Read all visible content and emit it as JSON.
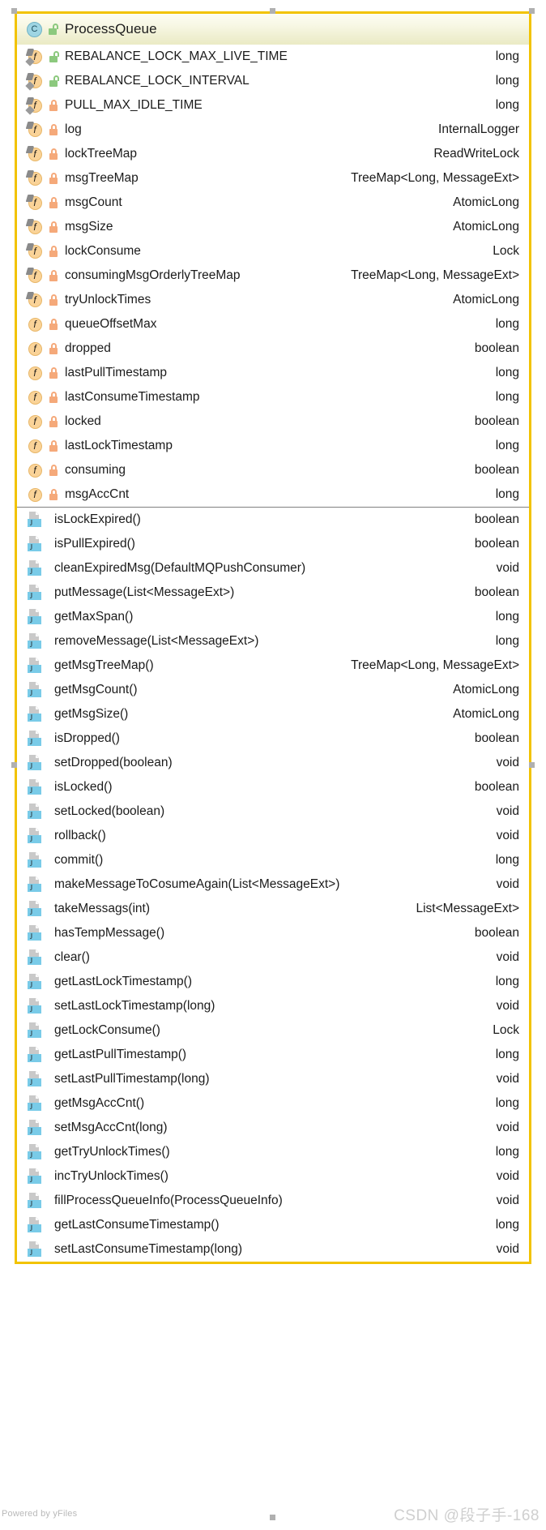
{
  "node": {
    "class_icon": "class-circle-icon",
    "visibility_icon": "unlock-icon",
    "name": "ProcessQueue"
  },
  "fields": [
    {
      "name": "REBALANCE_LOCK_MAX_LIVE_TIME",
      "type": "long",
      "visibility": "public",
      "static": true,
      "final": true
    },
    {
      "name": "REBALANCE_LOCK_INTERVAL",
      "type": "long",
      "visibility": "public",
      "static": true,
      "final": true
    },
    {
      "name": "PULL_MAX_IDLE_TIME",
      "type": "long",
      "visibility": "private",
      "static": true,
      "final": true
    },
    {
      "name": "log",
      "type": "InternalLogger",
      "visibility": "private",
      "static": false,
      "final": true
    },
    {
      "name": "lockTreeMap",
      "type": "ReadWriteLock",
      "visibility": "private",
      "static": false,
      "final": true
    },
    {
      "name": "msgTreeMap",
      "type": "TreeMap<Long, MessageExt>",
      "visibility": "private",
      "static": false,
      "final": true
    },
    {
      "name": "msgCount",
      "type": "AtomicLong",
      "visibility": "private",
      "static": false,
      "final": true
    },
    {
      "name": "msgSize",
      "type": "AtomicLong",
      "visibility": "private",
      "static": false,
      "final": true
    },
    {
      "name": "lockConsume",
      "type": "Lock",
      "visibility": "private",
      "static": false,
      "final": true
    },
    {
      "name": "consumingMsgOrderlyTreeMap",
      "type": "TreeMap<Long, MessageExt>",
      "visibility": "private",
      "static": false,
      "final": true
    },
    {
      "name": "tryUnlockTimes",
      "type": "AtomicLong",
      "visibility": "private",
      "static": false,
      "final": true
    },
    {
      "name": "queueOffsetMax",
      "type": "long",
      "visibility": "private",
      "static": false,
      "final": false
    },
    {
      "name": "dropped",
      "type": "boolean",
      "visibility": "private",
      "static": false,
      "final": false
    },
    {
      "name": "lastPullTimestamp",
      "type": "long",
      "visibility": "private",
      "static": false,
      "final": false
    },
    {
      "name": "lastConsumeTimestamp",
      "type": "long",
      "visibility": "private",
      "static": false,
      "final": false
    },
    {
      "name": "locked",
      "type": "boolean",
      "visibility": "private",
      "static": false,
      "final": false
    },
    {
      "name": "lastLockTimestamp",
      "type": "long",
      "visibility": "private",
      "static": false,
      "final": false
    },
    {
      "name": "consuming",
      "type": "boolean",
      "visibility": "private",
      "static": false,
      "final": false
    },
    {
      "name": "msgAccCnt",
      "type": "long",
      "visibility": "private",
      "static": false,
      "final": false
    }
  ],
  "methods": [
    {
      "name": "isLockExpired()",
      "type": "boolean"
    },
    {
      "name": "isPullExpired()",
      "type": "boolean"
    },
    {
      "name": "cleanExpiredMsg(DefaultMQPushConsumer)",
      "type": "void"
    },
    {
      "name": "putMessage(List<MessageExt>)",
      "type": "boolean"
    },
    {
      "name": "getMaxSpan()",
      "type": "long"
    },
    {
      "name": "removeMessage(List<MessageExt>)",
      "type": "long"
    },
    {
      "name": "getMsgTreeMap()",
      "type": "TreeMap<Long, MessageExt>"
    },
    {
      "name": "getMsgCount()",
      "type": "AtomicLong"
    },
    {
      "name": "getMsgSize()",
      "type": "AtomicLong"
    },
    {
      "name": "isDropped()",
      "type": "boolean"
    },
    {
      "name": "setDropped(boolean)",
      "type": "void"
    },
    {
      "name": "isLocked()",
      "type": "boolean"
    },
    {
      "name": "setLocked(boolean)",
      "type": "void"
    },
    {
      "name": "rollback()",
      "type": "void"
    },
    {
      "name": "commit()",
      "type": "long"
    },
    {
      "name": "makeMessageToCosumeAgain(List<MessageExt>)",
      "type": "void"
    },
    {
      "name": "takeMessags(int)",
      "type": "List<MessageExt>"
    },
    {
      "name": "hasTempMessage()",
      "type": "boolean"
    },
    {
      "name": "clear()",
      "type": "void"
    },
    {
      "name": "getLastLockTimestamp()",
      "type": "long"
    },
    {
      "name": "setLastLockTimestamp(long)",
      "type": "void"
    },
    {
      "name": "getLockConsume()",
      "type": "Lock"
    },
    {
      "name": "getLastPullTimestamp()",
      "type": "long"
    },
    {
      "name": "setLastPullTimestamp(long)",
      "type": "void"
    },
    {
      "name": "getMsgAccCnt()",
      "type": "long"
    },
    {
      "name": "setMsgAccCnt(long)",
      "type": "void"
    },
    {
      "name": "getTryUnlockTimes()",
      "type": "long"
    },
    {
      "name": "incTryUnlockTimes()",
      "type": "void"
    },
    {
      "name": "fillProcessQueueInfo(ProcessQueueInfo)",
      "type": "void"
    },
    {
      "name": "getLastConsumeTimestamp()",
      "type": "long"
    },
    {
      "name": "setLastConsumeTimestamp(long)",
      "type": "void"
    }
  ],
  "footer": {
    "yfiles_credit": "Powered by yFiles",
    "watermark": "CSDN @段子手-168"
  },
  "colors": {
    "border": "#f2c300",
    "header_top": "#fdfdf4",
    "header_bottom": "#eaeac4",
    "field_icon": "#fad398",
    "method_icon": "#79cbe8",
    "class_icon": "#9ed5e3",
    "lock_private": "#f5a97a",
    "lock_public": "#8cc97e",
    "handle": "#b0b0b0"
  }
}
